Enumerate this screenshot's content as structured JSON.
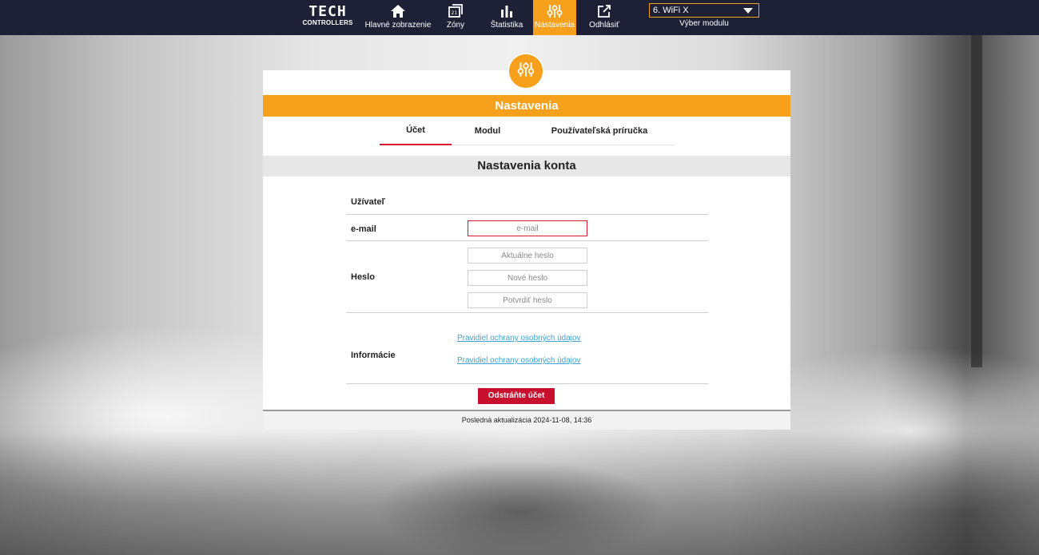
{
  "nav": {
    "logo_line1": "TECH",
    "logo_line2": "CONTROLLERS",
    "items": [
      {
        "label": "Hlavné zobrazenie",
        "icon": "home-icon"
      },
      {
        "label": "Zóny",
        "icon": "zones-icon"
      },
      {
        "label": "Štatistika",
        "icon": "statistics-icon"
      },
      {
        "label": "Nastavenia",
        "icon": "settings-sliders-icon",
        "active": true
      },
      {
        "label": "Odhlásiť",
        "icon": "logout-icon"
      }
    ],
    "module_select": {
      "value": "6. WiFi X",
      "caption": "Výber modulu"
    }
  },
  "page": {
    "banner": "Nastavenia",
    "tabs": [
      {
        "label": "Účet",
        "active": true
      },
      {
        "label": "Modul"
      },
      {
        "label": "Používateľská príručka"
      }
    ],
    "section_title": "Nastavenia konta"
  },
  "form": {
    "user_label": "Užívateľ",
    "email_label": "e-mail",
    "email_placeholder": "e-mail",
    "password_label": "Heslo",
    "current_password_placeholder": "Aktuálne heslo",
    "new_password_placeholder": "Nové heslo",
    "confirm_password_placeholder": "Potvrdiť heslo",
    "info_label": "Informácie",
    "links": [
      "Pravidiel ochrany osobných údajov",
      "Pravidiel ochrany osobných údajov"
    ],
    "delete_button": "Odstráňte účet"
  },
  "footer": {
    "last_update": "Posledná aktualizácia 2024-11-08, 14:36"
  },
  "colors": {
    "accent": "#f7a01b",
    "navbar": "#1e2136",
    "danger": "#c8102e",
    "link": "#3aa3d6"
  }
}
